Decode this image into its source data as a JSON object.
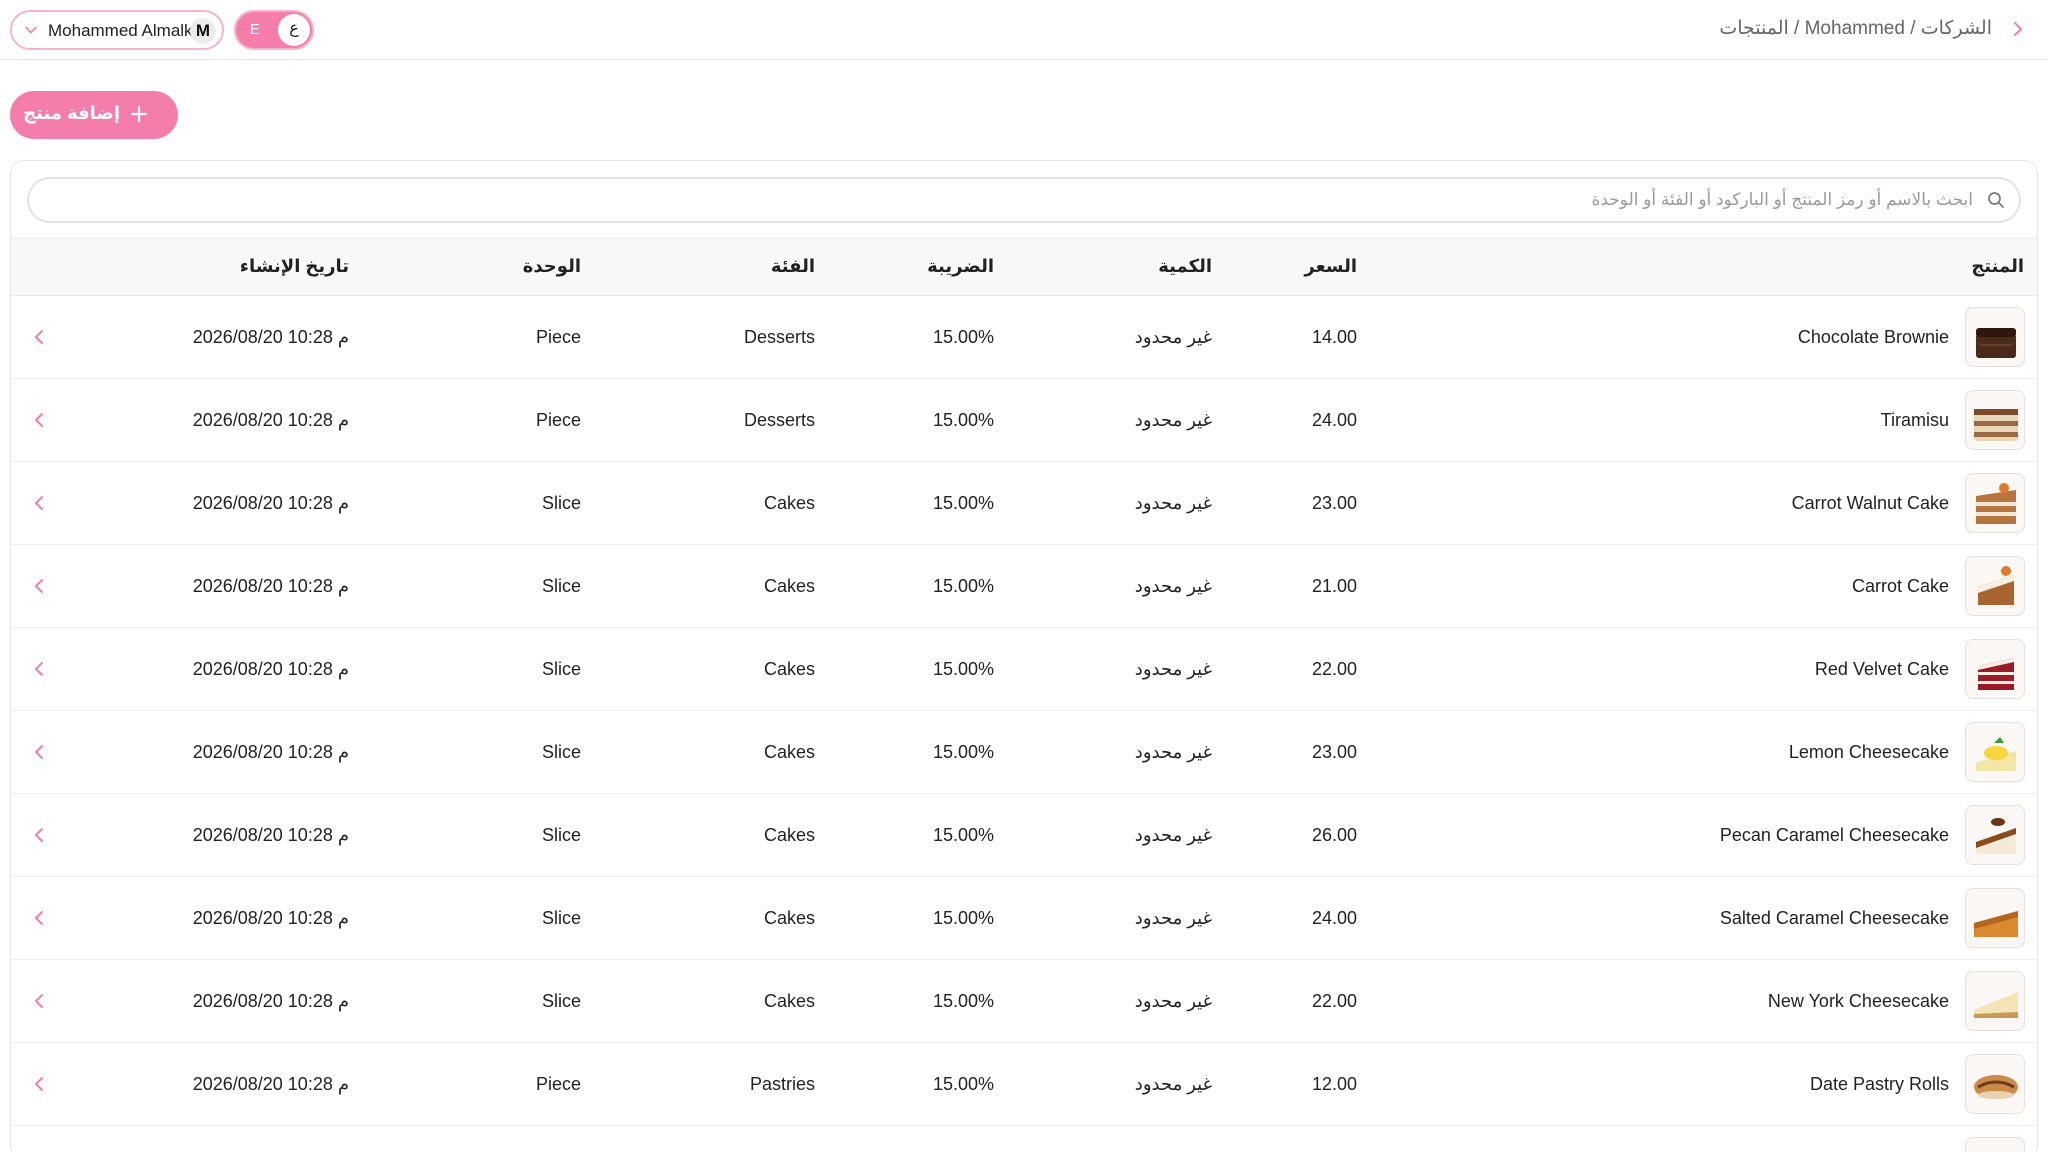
{
  "header": {
    "user_name": "Mohammed Almalki",
    "user_initial": "M",
    "lang_inactive": "E",
    "lang_active": "ع",
    "breadcrumb": "الشركات / Mohammed / المنتجات"
  },
  "toolbar": {
    "add_label": "إضافة منتج"
  },
  "search": {
    "placeholder": "ابحث بالاسم أو رمز المنتج أو الباركود أو الفئة أو الوحدة"
  },
  "table": {
    "columns": {
      "product": "المنتج",
      "price": "السعر",
      "quantity": "الكمية",
      "tax": "الضريبة",
      "category": "الفئة",
      "unit": "الوحدة",
      "created": "تاريخ الإنشاء"
    },
    "rows": [
      {
        "name": "Chocolate Brownie",
        "price": "14.00",
        "qty": "غير محدود",
        "tax": "15.00%",
        "category": "Desserts",
        "unit": "Piece",
        "created": "2026/08/20 10:28 م",
        "thumb": "brownie"
      },
      {
        "name": "Tiramisu",
        "price": "24.00",
        "qty": "غير محدود",
        "tax": "15.00%",
        "category": "Desserts",
        "unit": "Piece",
        "created": "2026/08/20 10:28 م",
        "thumb": "tiramisu"
      },
      {
        "name": "Carrot Walnut Cake",
        "price": "23.00",
        "qty": "غير محدود",
        "tax": "15.00%",
        "category": "Cakes",
        "unit": "Slice",
        "created": "2026/08/20 10:28 م",
        "thumb": "carrot-walnut"
      },
      {
        "name": "Carrot Cake",
        "price": "21.00",
        "qty": "غير محدود",
        "tax": "15.00%",
        "category": "Cakes",
        "unit": "Slice",
        "created": "2026/08/20 10:28 م",
        "thumb": "carrot"
      },
      {
        "name": "Red Velvet Cake",
        "price": "22.00",
        "qty": "غير محدود",
        "tax": "15.00%",
        "category": "Cakes",
        "unit": "Slice",
        "created": "2026/08/20 10:28 م",
        "thumb": "red-velvet"
      },
      {
        "name": "Lemon Cheesecake",
        "price": "23.00",
        "qty": "غير محدود",
        "tax": "15.00%",
        "category": "Cakes",
        "unit": "Slice",
        "created": "2026/08/20 10:28 م",
        "thumb": "lemon"
      },
      {
        "name": "Pecan Caramel Cheesecake",
        "price": "26.00",
        "qty": "غير محدود",
        "tax": "15.00%",
        "category": "Cakes",
        "unit": "Slice",
        "created": "2026/08/20 10:28 م",
        "thumb": "pecan"
      },
      {
        "name": "Salted Caramel Cheesecake",
        "price": "24.00",
        "qty": "غير محدود",
        "tax": "15.00%",
        "category": "Cakes",
        "unit": "Slice",
        "created": "2026/08/20 10:28 م",
        "thumb": "salted-caramel"
      },
      {
        "name": "New York Cheesecake",
        "price": "22.00",
        "qty": "غير محدود",
        "tax": "15.00%",
        "category": "Cakes",
        "unit": "Slice",
        "created": "2026/08/20 10:28 م",
        "thumb": "new-york"
      },
      {
        "name": "Date Pastry Rolls",
        "price": "12.00",
        "qty": "غير محدود",
        "tax": "15.00%",
        "category": "Pastries",
        "unit": "Piece",
        "created": "2026/08/20 10:28 م",
        "thumb": "date-rolls"
      },
      {
        "name": "",
        "price": "",
        "qty": "",
        "tax": "",
        "category": "",
        "unit": "",
        "created": "",
        "thumb": "partial"
      }
    ]
  },
  "colors": {
    "accent": "#f57dab",
    "accent_border": "#f6b3c9"
  }
}
